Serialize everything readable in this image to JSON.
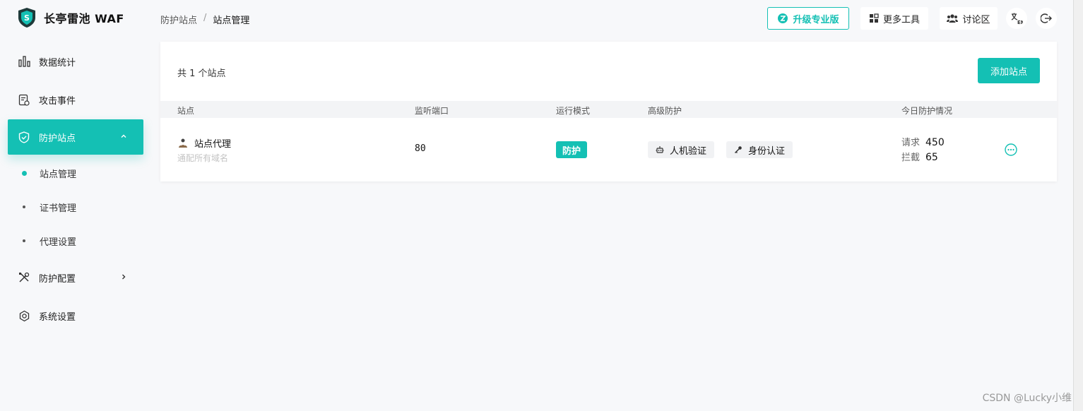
{
  "app": {
    "title": "长亭雷池 WAF"
  },
  "sidebar": {
    "items": [
      {
        "label": "数据统计",
        "icon": "bar-chart-icon"
      },
      {
        "label": "攻击事件",
        "icon": "event-icon"
      },
      {
        "label": "防护站点",
        "icon": "shield-icon",
        "active": true,
        "expanded": true
      },
      {
        "label": "防护配置",
        "icon": "tools-icon"
      },
      {
        "label": "系统设置",
        "icon": "gear-icon"
      }
    ],
    "sub_items": [
      {
        "label": "站点管理",
        "active": true
      },
      {
        "label": "证书管理"
      },
      {
        "label": "代理设置"
      }
    ]
  },
  "breadcrumb": {
    "parent": "防护站点",
    "separator": "/",
    "current": "站点管理"
  },
  "header": {
    "upgrade_label": "升级专业版",
    "tools_label": "更多工具",
    "forum_label": "讨论区"
  },
  "main": {
    "site_count_text": "共 1 个站点",
    "add_button_label": "添加站点",
    "columns": [
      "站点",
      "监听端口",
      "运行模式",
      "高级防护",
      "今日防护情况"
    ],
    "rows": [
      {
        "name": "站点代理",
        "subtitle": "通配所有域名",
        "port": "80",
        "mode": "防护",
        "advanced": [
          "人机验证",
          "身份认证"
        ],
        "stats": {
          "request_label": "请求",
          "request_value": "450",
          "block_label": "拦截",
          "block_value": "65"
        }
      }
    ]
  },
  "watermark": "CSDN @Lucky小维",
  "colors": {
    "accent": "#14c0b4",
    "background": "#f7f8fa"
  }
}
